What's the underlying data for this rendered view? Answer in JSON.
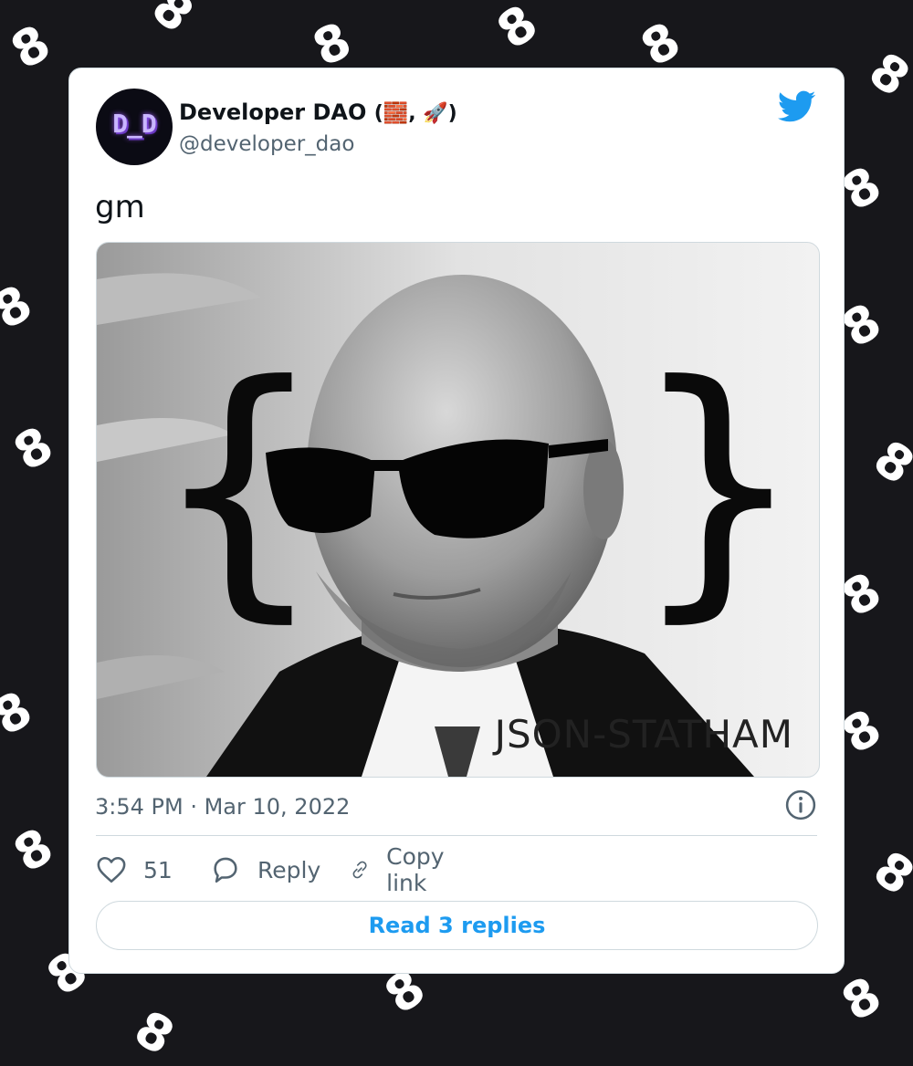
{
  "tweet": {
    "author": {
      "name": "Developer DAO",
      "name_emoji": "(🧱, 🚀)",
      "handle": "@developer_dao",
      "avatar_text": "D_D"
    },
    "text": "gm",
    "media": {
      "caption": "JSON-STATHAM"
    },
    "timestamp": "3:54 PM · Mar 10, 2022",
    "actions": {
      "like_count": "51",
      "reply_label": "Reply",
      "copy_link_label": "Copy link"
    },
    "read_replies_label": "Read 3 replies"
  },
  "colors": {
    "background": "#17171b",
    "twitter_blue": "#1d9bf0",
    "text_primary": "#0f1419",
    "text_secondary": "#536471"
  },
  "icons": [
    "twitter-bird-icon",
    "info-icon",
    "heart-icon",
    "reply-bubble-icon",
    "link-icon"
  ],
  "background_glyph": "8"
}
